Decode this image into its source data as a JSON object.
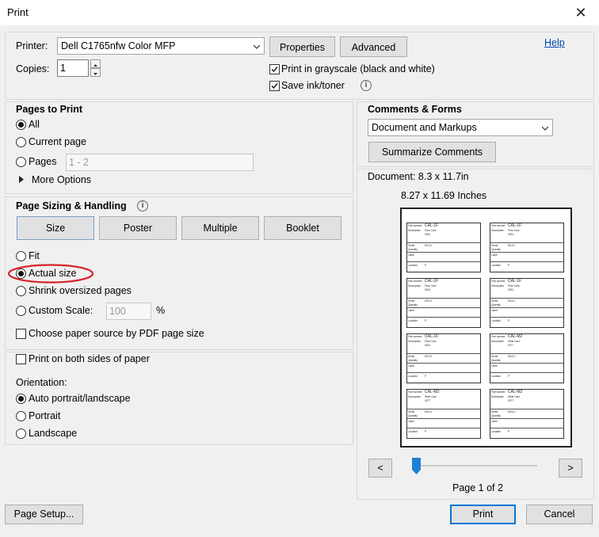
{
  "window": {
    "title": "Print",
    "close_glyph": "✕"
  },
  "printer": {
    "label": "Printer:",
    "value": "Dell C1765nfw Color MFP",
    "properties_label": "Properties",
    "advanced_label": "Advanced",
    "help_label": "Help",
    "copies_label": "Copies:",
    "copies_value": "1",
    "grayscale_label": "Print in grayscale (black and white)",
    "grayscale_checked": true,
    "save_ink_label": "Save ink/toner",
    "save_ink_checked": true
  },
  "pages_to_print": {
    "heading": "Pages to Print",
    "all_label": "All",
    "current_label": "Current page",
    "pages_label": "Pages",
    "pages_value": "1 - 2",
    "more_options_label": "More Options",
    "selected": "All"
  },
  "sizing": {
    "heading": "Page Sizing & Handling",
    "size_label": "Size",
    "poster_label": "Poster",
    "multiple_label": "Multiple",
    "booklet_label": "Booklet",
    "fit_label": "Fit",
    "actual_label": "Actual size",
    "shrink_label": "Shrink oversized pages",
    "custom_label": "Custom Scale:",
    "custom_value": "100",
    "percent": "%",
    "paper_source_label": "Choose paper source by PDF page size",
    "selected": "Actual size",
    "highlight_color": "#d6232a"
  },
  "duplex": {
    "label": "Print on both sides of paper"
  },
  "orientation": {
    "heading": "Orientation:",
    "auto_label": "Auto portrait/landscape",
    "portrait_label": "Portrait",
    "landscape_label": "Landscape",
    "selected": "Auto portrait/landscape"
  },
  "comments": {
    "heading": "Comments & Forms",
    "value": "Document and Markups",
    "summarize_label": "Summarize Comments"
  },
  "preview": {
    "document_size": "Document: 8.3 x 11.7in",
    "paper_size": "8.27 x 11.69 Inches",
    "page_label": "Page 1 of 2",
    "prev_glyph": "<",
    "next_glyph": ">",
    "cards": [
      {
        "code": "CAL-1F",
        "desc": "Flow Cam",
        "num": "0001",
        "id": "EN-01"
      },
      {
        "code": "CAL-1F",
        "desc": "Flow Cam",
        "num": "0001",
        "id": "EN-01"
      },
      {
        "code": "CAL-1F",
        "desc": "Flow Cam",
        "num": "0001",
        "id": "EN-01"
      },
      {
        "code": "CAL-1F",
        "desc": "Flow Cam",
        "num": "0001",
        "id": "EN-01"
      },
      {
        "code": "CAL-1F",
        "desc": "Flow Cam",
        "num": "0001",
        "id": "EN-01"
      },
      {
        "code": "CAL-M2",
        "desc": "Wide Cam",
        "num": "0077",
        "id": "EN-01"
      },
      {
        "code": "CAL-M2",
        "desc": "Wide Cam",
        "num": "0077",
        "id": "EN-01"
      },
      {
        "code": "CAL-M2",
        "desc": "Wide Cam",
        "num": "0077",
        "id": "EN-01"
      }
    ],
    "card_fields": {
      "f1": "Part number",
      "f2": "Description",
      "f3": "Serial",
      "f4": "Quantity",
      "f5": "Label",
      "f6": "Location"
    }
  },
  "footer": {
    "page_setup_label": "Page Setup...",
    "print_label": "Print",
    "cancel_label": "Cancel"
  },
  "colors": {
    "accent": "#0078d7",
    "link": "#0645ad",
    "slider": "#1f7fd6"
  }
}
